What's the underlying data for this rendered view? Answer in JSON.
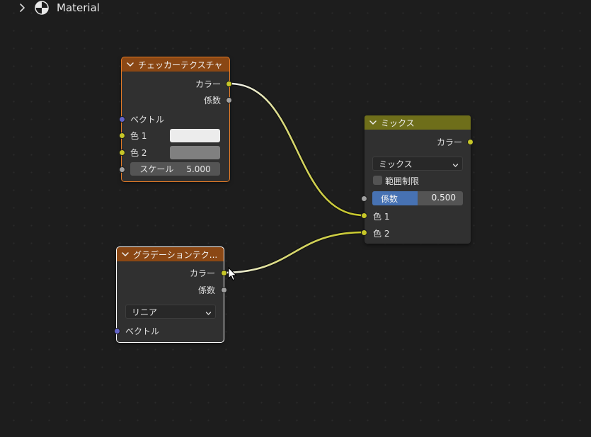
{
  "breadcrumb": {
    "label": "Material"
  },
  "colors": {
    "background": "#1d1d1d",
    "node_body": "#303030",
    "texture_header": "#8a4714",
    "mix_header": "#6e6e1a",
    "selected_outline_active": "#e87c26",
    "selected_outline": "#ffffff",
    "socket_color": "#c7c729",
    "socket_float": "#a1a1a1",
    "socket_vector": "#6363c7",
    "slider_fill": "#4772b3"
  },
  "nodes": {
    "checker": {
      "title": "チェッカーテクスチャ",
      "outputs": {
        "color": "カラー",
        "fac": "係数"
      },
      "inputs": {
        "vector": "ベクトル",
        "color1": "色 1",
        "color2": "色 2"
      },
      "color1_value": "#ececec",
      "color2_value": "#808080",
      "scale": {
        "label": "スケール",
        "value": "5.000"
      }
    },
    "gradient": {
      "title": "グラデーションテク...",
      "outputs": {
        "color": "カラー",
        "fac": "係数"
      },
      "type_select": "リニア",
      "inputs": {
        "vector": "ベクトル"
      }
    },
    "mix": {
      "title": "ミックス",
      "outputs": {
        "color": "カラー"
      },
      "blend_select": "ミックス",
      "clamp": {
        "label": "範囲制限",
        "checked": false
      },
      "fac": {
        "label": "係数",
        "value": "0.500",
        "fraction": 0.5
      },
      "inputs": {
        "color1": "色 1",
        "color2": "色 2"
      }
    }
  }
}
